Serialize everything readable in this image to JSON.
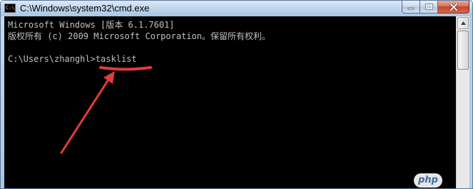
{
  "window": {
    "title": "C:\\Windows\\system32\\cmd.exe",
    "icon_label": "C:\\",
    "buttons": {
      "minimize": "minimize-icon",
      "maximize": "maximize-icon",
      "close": "close-icon"
    }
  },
  "console": {
    "lines": [
      "Microsoft Windows [版本 6.1.7601]",
      "版权所有 (c) 2009 Microsoft Corporation。保留所有权利。",
      "",
      "C:\\Users\\zhanghl>tasklist"
    ],
    "text_color": "#c0c0c0",
    "background": "#000000"
  },
  "annotation": {
    "color": "#e23b3b"
  },
  "watermark": {
    "text": "php"
  }
}
